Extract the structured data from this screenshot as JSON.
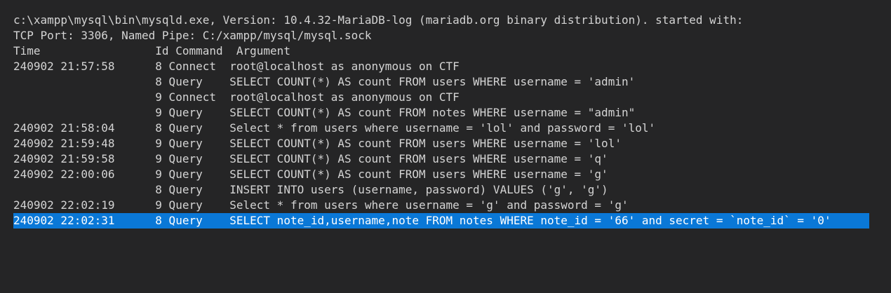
{
  "log": {
    "lines": [
      "c:\\xampp\\mysql\\bin\\mysqld.exe, Version: 10.4.32-MariaDB-log (mariadb.org binary distribution). started with:",
      "TCP Port: 3306, Named Pipe: C:/xampp/mysql/mysql.sock",
      "Time                 Id Command  Argument",
      "240902 21:57:58      8 Connect  root@localhost as anonymous on CTF",
      "                     8 Query    SELECT COUNT(*) AS count FROM users WHERE username = 'admin'",
      "                     9 Connect  root@localhost as anonymous on CTF",
      "                     9 Query    SELECT COUNT(*) AS count FROM notes WHERE username = \"admin\"",
      "240902 21:58:04      8 Query    Select * from users where username = 'lol' and password = 'lol'",
      "240902 21:59:48      9 Query    SELECT COUNT(*) AS count FROM users WHERE username = 'lol'",
      "240902 21:59:58      9 Query    SELECT COUNT(*) AS count FROM users WHERE username = 'q'",
      "240902 22:00:06      9 Query    SELECT COUNT(*) AS count FROM users WHERE username = 'g'",
      "                     8 Query    INSERT INTO users (username, password) VALUES ('g', 'g')",
      "240902 22:02:19      9 Query    Select * from users where username = 'g' and password = 'g'",
      "240902 22:02:31      8 Query    SELECT note_id,username,note FROM notes WHERE note_id = '66' and secret = `note_id` = '0'"
    ],
    "selected_line_index": 13
  },
  "colors": {
    "background": "#252526",
    "text": "#d4d4d4",
    "selection_background": "#0a78d7",
    "selection_text": "#ffffff"
  }
}
